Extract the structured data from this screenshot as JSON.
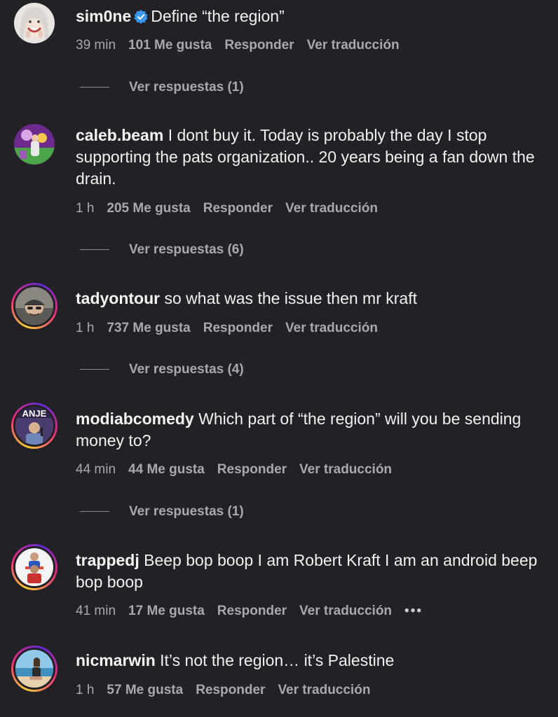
{
  "labels": {
    "like_suffix": "Me gusta",
    "reply": "Responder",
    "translate": "Ver traducción",
    "more": "•••"
  },
  "comments": [
    {
      "username": "sim0ne",
      "verified": true,
      "text": "Define “the region”",
      "time": "39 min",
      "likes": "101 Me gusta",
      "replies": "Ver respuestas (1)",
      "avatar_icon": "woman-smiling-avatar"
    },
    {
      "username": "caleb.beam",
      "verified": false,
      "text": "I dont buy it. Today is probably the day I stop supporting the pats organization.. 20 years being a fan down the drain.",
      "time": "1 h",
      "likes": "205 Me gusta",
      "replies": "Ver respuestas (6)",
      "avatar_icon": "purple-scene-avatar"
    },
    {
      "username": "tadyontour",
      "verified": false,
      "text": "so what was the issue then mr kraft",
      "time": "1 h",
      "likes": "737 Me gusta",
      "replies": "Ver respuestas (4)",
      "avatar_icon": "man-cap-avatar"
    },
    {
      "username": "modiabcomedy",
      "verified": false,
      "text": "Which part of “the region” will you be sending money to?",
      "time": "44 min",
      "likes": "44 Me gusta",
      "replies": "Ver respuestas (1)",
      "avatar_icon": "comedian-stage-avatar",
      "avatar_text": "ANJE"
    },
    {
      "username": "trappedj",
      "verified": false,
      "text": "Beep bop boop I am Robert Kraft I am an android beep bop boop",
      "time": "41 min",
      "likes": "17 Me gusta",
      "show_more": true,
      "avatar_icon": "figure-on-shoulders-avatar"
    },
    {
      "username": "nicmarwin",
      "verified": false,
      "text": "It’s not the region… it’s Palestine",
      "time": "1 h",
      "likes": "57 Me gusta",
      "avatar_icon": "woman-beach-avatar"
    }
  ],
  "colors": {
    "background": "#212126",
    "text": "#f2f2f4",
    "meta": "#a8a8b0",
    "verified": "#3897f0"
  }
}
